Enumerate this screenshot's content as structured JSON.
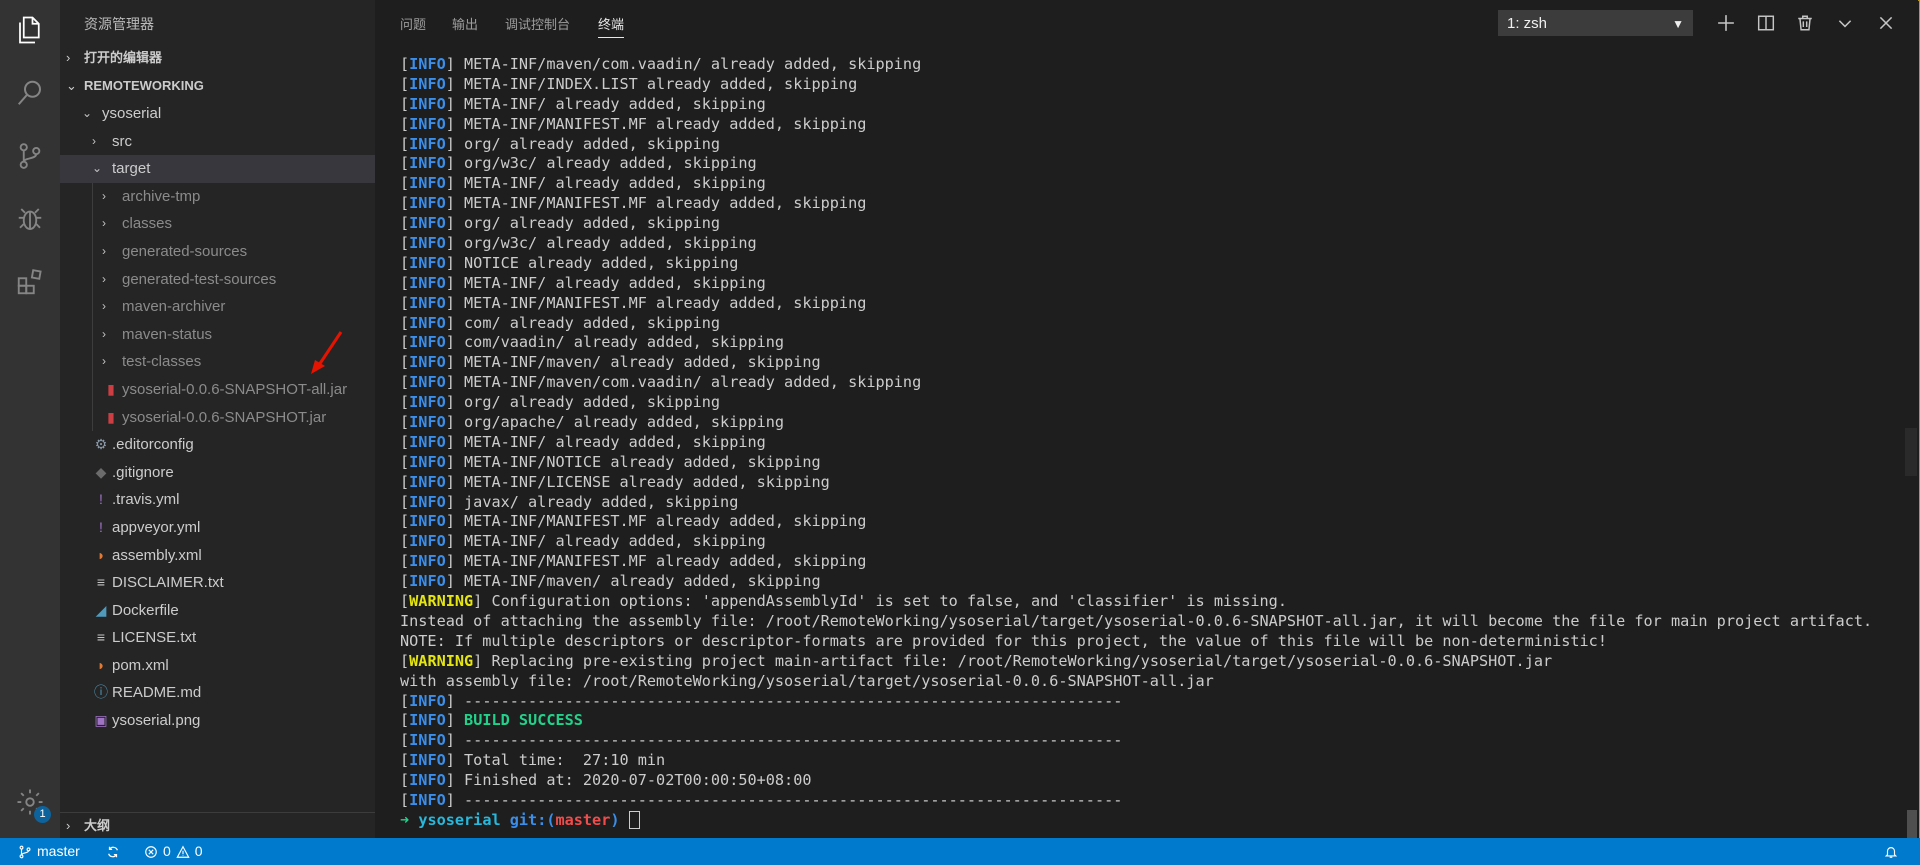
{
  "explorer": {
    "title": "资源管理器",
    "open_editors": "打开的编辑器",
    "workspace": "REMOTEWORKING",
    "outline": "大纲",
    "tree": [
      {
        "label": "ysoserial",
        "type": "folder-open",
        "depth": 1
      },
      {
        "label": "src",
        "type": "folder",
        "depth": 2
      },
      {
        "label": "target",
        "type": "folder-open",
        "depth": 2,
        "selected": true
      },
      {
        "label": "archive-tmp",
        "type": "folder",
        "depth": 3,
        "dim": true
      },
      {
        "label": "classes",
        "type": "folder",
        "depth": 3,
        "dim": true
      },
      {
        "label": "generated-sources",
        "type": "folder",
        "depth": 3,
        "dim": true
      },
      {
        "label": "generated-test-sources",
        "type": "folder",
        "depth": 3,
        "dim": true
      },
      {
        "label": "maven-archiver",
        "type": "folder",
        "depth": 3,
        "dim": true
      },
      {
        "label": "maven-status",
        "type": "folder",
        "depth": 3,
        "dim": true
      },
      {
        "label": "test-classes",
        "type": "folder",
        "depth": 3,
        "dim": true
      },
      {
        "label": "ysoserial-0.0.6-SNAPSHOT-all.jar",
        "type": "jar",
        "depth": 3,
        "dim": true
      },
      {
        "label": "ysoserial-0.0.6-SNAPSHOT.jar",
        "type": "jar",
        "depth": 3,
        "dim": true
      },
      {
        "label": ".editorconfig",
        "type": "gear",
        "depth": 2
      },
      {
        "label": ".gitignore",
        "type": "git",
        "depth": 2
      },
      {
        "label": ".travis.yml",
        "type": "yml",
        "depth": 2
      },
      {
        "label": "appveyor.yml",
        "type": "yml",
        "depth": 2
      },
      {
        "label": "assembly.xml",
        "type": "rss",
        "depth": 2
      },
      {
        "label": "DISCLAIMER.txt",
        "type": "txt",
        "depth": 2
      },
      {
        "label": "Dockerfile",
        "type": "docker",
        "depth": 2
      },
      {
        "label": "LICENSE.txt",
        "type": "txt",
        "depth": 2
      },
      {
        "label": "pom.xml",
        "type": "rss",
        "depth": 2
      },
      {
        "label": "README.md",
        "type": "info",
        "depth": 2
      },
      {
        "label": "ysoserial.png",
        "type": "image",
        "depth": 2
      }
    ]
  },
  "panel": {
    "tabs": [
      "问题",
      "输出",
      "调试控制台",
      "终端"
    ],
    "active_tab": "终端",
    "terminal_select": "1: zsh"
  },
  "terminal": [
    {
      "tag": "INFO",
      "text": " META-INF/maven/com.vaadin/ already added, skipping"
    },
    {
      "tag": "INFO",
      "text": " META-INF/INDEX.LIST already added, skipping"
    },
    {
      "tag": "INFO",
      "text": " META-INF/ already added, skipping"
    },
    {
      "tag": "INFO",
      "text": " META-INF/MANIFEST.MF already added, skipping"
    },
    {
      "tag": "INFO",
      "text": " org/ already added, skipping"
    },
    {
      "tag": "INFO",
      "text": " org/w3c/ already added, skipping"
    },
    {
      "tag": "INFO",
      "text": " META-INF/ already added, skipping"
    },
    {
      "tag": "INFO",
      "text": " META-INF/MANIFEST.MF already added, skipping"
    },
    {
      "tag": "INFO",
      "text": " org/ already added, skipping"
    },
    {
      "tag": "INFO",
      "text": " org/w3c/ already added, skipping"
    },
    {
      "tag": "INFO",
      "text": " NOTICE already added, skipping"
    },
    {
      "tag": "INFO",
      "text": " META-INF/ already added, skipping"
    },
    {
      "tag": "INFO",
      "text": " META-INF/MANIFEST.MF already added, skipping"
    },
    {
      "tag": "INFO",
      "text": " com/ already added, skipping"
    },
    {
      "tag": "INFO",
      "text": " com/vaadin/ already added, skipping"
    },
    {
      "tag": "INFO",
      "text": " META-INF/maven/ already added, skipping"
    },
    {
      "tag": "INFO",
      "text": " META-INF/maven/com.vaadin/ already added, skipping"
    },
    {
      "tag": "INFO",
      "text": " org/ already added, skipping"
    },
    {
      "tag": "INFO",
      "text": " org/apache/ already added, skipping"
    },
    {
      "tag": "INFO",
      "text": " META-INF/ already added, skipping"
    },
    {
      "tag": "INFO",
      "text": " META-INF/NOTICE already added, skipping"
    },
    {
      "tag": "INFO",
      "text": " META-INF/LICENSE already added, skipping"
    },
    {
      "tag": "INFO",
      "text": " javax/ already added, skipping"
    },
    {
      "tag": "INFO",
      "text": " META-INF/MANIFEST.MF already added, skipping"
    },
    {
      "tag": "INFO",
      "text": " META-INF/ already added, skipping"
    },
    {
      "tag": "INFO",
      "text": " META-INF/MANIFEST.MF already added, skipping"
    },
    {
      "tag": "INFO",
      "text": " META-INF/maven/ already added, skipping"
    },
    {
      "tag": "WARNING",
      "text": " Configuration options: 'appendAssemblyId' is set to false, and 'classifier' is missing."
    },
    {
      "tag": "",
      "text": "Instead of attaching the assembly file: /root/RemoteWorking/ysoserial/target/ysoserial-0.0.6-SNAPSHOT-all.jar, it will become the file for main project artifact."
    },
    {
      "tag": "",
      "text": "NOTE: If multiple descriptors or descriptor-formats are provided for this project, the value of this file will be non-deterministic!"
    },
    {
      "tag": "WARNING",
      "text": " Replacing pre-existing project main-artifact file: /root/RemoteWorking/ysoserial/target/ysoserial-0.0.6-SNAPSHOT.jar"
    },
    {
      "tag": "",
      "text": "with assembly file: /root/RemoteWorking/ysoserial/target/ysoserial-0.0.6-SNAPSHOT-all.jar"
    },
    {
      "tag": "INFO",
      "text": " ------------------------------------------------------------------------"
    },
    {
      "tag": "INFO",
      "text": " ",
      "success": "BUILD SUCCESS"
    },
    {
      "tag": "INFO",
      "text": " ------------------------------------------------------------------------"
    },
    {
      "tag": "INFO",
      "text": " Total time:  27:10 min"
    },
    {
      "tag": "INFO",
      "text": " Finished at: 2020-07-02T00:00:50+08:00"
    },
    {
      "tag": "INFO",
      "text": " ------------------------------------------------------------------------"
    }
  ],
  "prompt": {
    "arrow": "➜",
    "dir": "ysoserial",
    "git": "git:(",
    "branch": "master",
    "close": ")"
  },
  "status": {
    "branch": "master",
    "errors": "0",
    "warnings": "0"
  },
  "settings_badge": "1",
  "colors": {
    "accent": "#007acc",
    "info": "#3b8eea",
    "warning": "#e5e510",
    "success": "#23d18b",
    "annotation": "#e51400"
  }
}
